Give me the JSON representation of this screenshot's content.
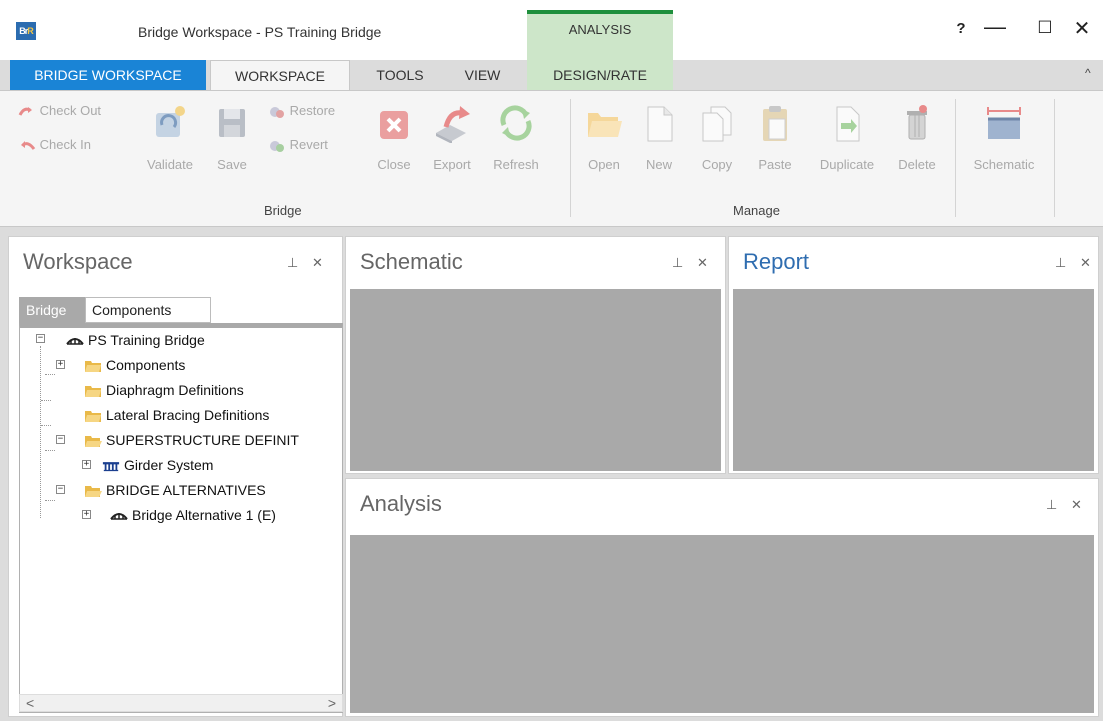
{
  "window": {
    "title": "Bridge Workspace - PS Training Bridge",
    "logo_text": "BrR",
    "help": "?",
    "minimize": "—",
    "maximize": "☐",
    "close": "✕"
  },
  "context_group": {
    "title": "ANALYSIS"
  },
  "tabs": {
    "file": "BRIDGE WORKSPACE",
    "workspace": "WORKSPACE",
    "tools": "TOOLS",
    "view": "VIEW",
    "design_rate": "DESIGN/RATE",
    "collapse": "^"
  },
  "ribbon": {
    "bridge_group": {
      "label": "Bridge",
      "check_out": "Check Out",
      "check_in": "Check In",
      "validate": "Validate",
      "save": "Save",
      "restore": "Restore",
      "revert": "Revert",
      "close": "Close",
      "export": "Export",
      "refresh": "Refresh"
    },
    "manage_group": {
      "label": "Manage",
      "open": "Open",
      "new": "New",
      "copy": "Copy",
      "paste": "Paste",
      "duplicate": "Duplicate",
      "delete": "Delete"
    },
    "schematic_group": {
      "schematic": "Schematic"
    }
  },
  "workspace_panel": {
    "title": "Workspace",
    "tabs": [
      "Bridge",
      "Components"
    ],
    "tree": {
      "root": "PS Training Bridge",
      "components": "Components",
      "diaphragm": "Diaphragm Definitions",
      "lateral": "Lateral Bracing Definitions",
      "superstructure": "SUPERSTRUCTURE DEFINIT",
      "girder_system": "Girder System",
      "alternatives": "BRIDGE ALTERNATIVES",
      "alt1": "Bridge Alternative 1  (E)"
    },
    "scroll_left": "<",
    "scroll_right": ">"
  },
  "schematic_panel": {
    "title": "Schematic"
  },
  "report_panel": {
    "title": "Report"
  },
  "analysis_panel": {
    "title": "Analysis"
  },
  "panel_controls": {
    "pin": "⊥",
    "close": "✕"
  },
  "colors": {
    "accent_blue": "#1a84d6",
    "analysis_green": "#1e8f3c",
    "analysis_bg": "#cde6c9",
    "disabled_text": "#a9a9a9",
    "panel_gray": "#a9a9a9"
  }
}
